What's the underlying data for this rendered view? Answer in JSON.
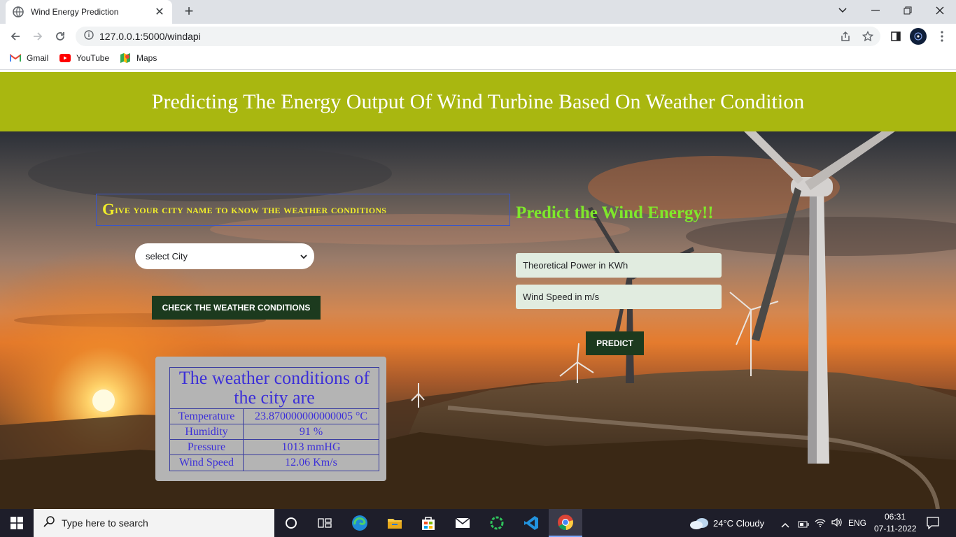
{
  "browser": {
    "tab_title": "Wind Energy Prediction",
    "new_tab_symbol": "+",
    "url": "127.0.0.1:5000/windapi",
    "bookmarks": [
      {
        "label": "Gmail",
        "icon": "gmail-icon"
      },
      {
        "label": "YouTube",
        "icon": "youtube-icon"
      },
      {
        "label": "Maps",
        "icon": "maps-icon"
      }
    ]
  },
  "page": {
    "banner_title": "Predicting The Energy Output Of Wind Turbine Based On Weather Condition",
    "city_heading_first": "G",
    "city_heading_rest": "ive your city name to know the weather conditions",
    "city_select_value": "select City",
    "check_button": "CHECK THE WEATHER CONDITIONS",
    "weather": {
      "title": "The weather conditions of the city are",
      "rows": [
        {
          "label": "Temperature",
          "value": "23.870000000000005 °C"
        },
        {
          "label": "Humidity",
          "value": "91 %"
        },
        {
          "label": "Pressure",
          "value": "1013 mmHG"
        },
        {
          "label": "Wind Speed",
          "value": "12.06 Km/s"
        }
      ]
    },
    "predict_heading": "Predict the Wind Energy!!",
    "inputs": {
      "power_placeholder": "Theoretical Power in KWh",
      "speed_placeholder": "Wind Speed in m/s"
    },
    "predict_button": "PREDICT"
  },
  "taskbar": {
    "search_placeholder": "Type here to search",
    "weather": "24°C  Cloudy",
    "language": "ENG",
    "time": "06:31",
    "date": "07-11-2022"
  },
  "colors": {
    "banner": "#a9b710",
    "city_heading": "#f2ee2a",
    "predict_heading": "#7fe82b",
    "button": "#1c3a1e",
    "weather_text": "#3c2fd8"
  }
}
